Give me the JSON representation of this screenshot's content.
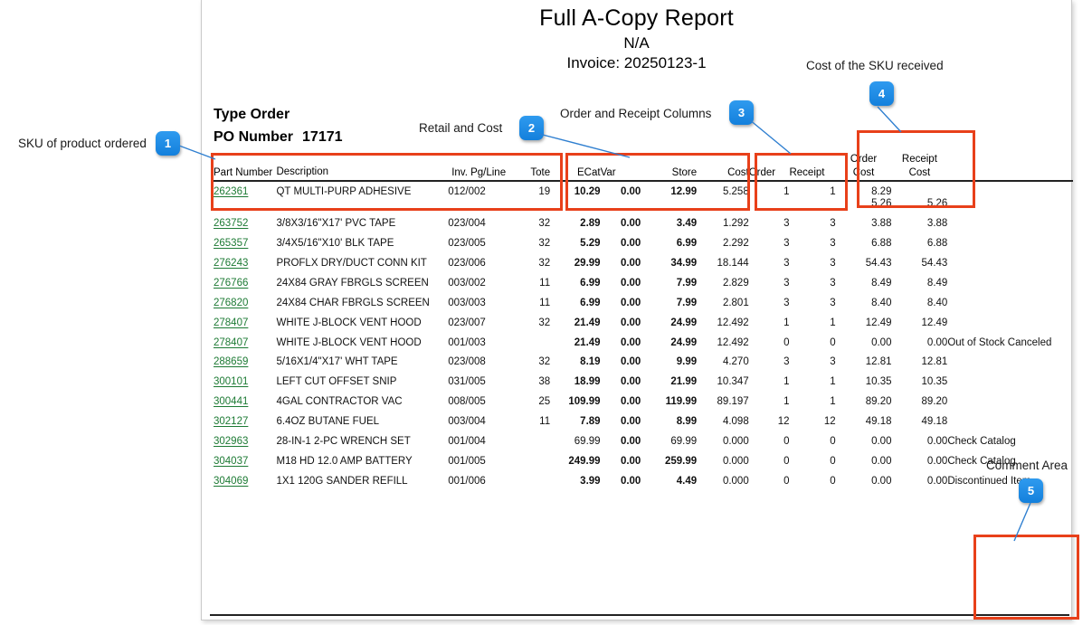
{
  "report": {
    "title": "Full A-Copy Report",
    "subtitle": "N/A",
    "invoice": "Invoice: 20250123-1",
    "type_order": "Type Order",
    "po_label": "PO Number",
    "po_value": "17171"
  },
  "columns": {
    "part_number": "Part Number",
    "description": "Description",
    "inv": "Inv. Pg/Line",
    "tote": "Tote",
    "ecat": "ECat",
    "var": "Var",
    "store": "Store",
    "cost": "Cost",
    "order": "Order",
    "receipt": "Receipt",
    "order_cost_l1": "Order",
    "order_cost_l2": "Cost",
    "receipt_cost_l1": "Receipt",
    "receipt_cost_l2": "Cost"
  },
  "rows": [
    {
      "part": "262361",
      "desc": "QT MULTI-PURP ADHESIVE",
      "inv": "012/002",
      "tote": "19",
      "ecat": "10.29",
      "var": "0.00",
      "store": "12.99",
      "cost": "5.258",
      "order": "1",
      "receipt": "1",
      "order_cost": "5.26",
      "order_cost_alt": "8.29",
      "receipt_cost": "5.26",
      "comment": ""
    },
    {
      "part": "263752",
      "desc": "3/8X3/16\"X17' PVC TAPE",
      "inv": "023/004",
      "tote": "32",
      "ecat": "2.89",
      "var": "0.00",
      "store": "3.49",
      "cost": "1.292",
      "order": "3",
      "receipt": "3",
      "order_cost": "3.88",
      "order_cost_alt": "",
      "receipt_cost": "3.88",
      "comment": ""
    },
    {
      "part": "265357",
      "desc": "3/4X5/16\"X10' BLK TAPE",
      "inv": "023/005",
      "tote": "32",
      "ecat": "5.29",
      "var": "0.00",
      "store": "6.99",
      "cost": "2.292",
      "order": "3",
      "receipt": "3",
      "order_cost": "6.88",
      "order_cost_alt": "",
      "receipt_cost": "6.88",
      "comment": ""
    },
    {
      "part": "276243",
      "desc": "PROFLX DRY/DUCT CONN KIT",
      "inv": "023/006",
      "tote": "32",
      "ecat": "29.99",
      "var": "0.00",
      "store": "34.99",
      "cost": "18.144",
      "order": "3",
      "receipt": "3",
      "order_cost": "54.43",
      "order_cost_alt": "",
      "receipt_cost": "54.43",
      "comment": ""
    },
    {
      "part": "276766",
      "desc": "24X84 GRAY FBRGLS SCREEN",
      "inv": "003/002",
      "tote": "11",
      "ecat": "6.99",
      "var": "0.00",
      "store": "7.99",
      "cost": "2.829",
      "order": "3",
      "receipt": "3",
      "order_cost": "8.49",
      "order_cost_alt": "",
      "receipt_cost": "8.49",
      "comment": ""
    },
    {
      "part": "276820",
      "desc": "24X84 CHAR FBRGLS SCREEN",
      "inv": "003/003",
      "tote": "11",
      "ecat": "6.99",
      "var": "0.00",
      "store": "7.99",
      "cost": "2.801",
      "order": "3",
      "receipt": "3",
      "order_cost": "8.40",
      "order_cost_alt": "",
      "receipt_cost": "8.40",
      "comment": ""
    },
    {
      "part": "278407",
      "desc": "WHITE J-BLOCK VENT HOOD",
      "inv": "023/007",
      "tote": "32",
      "ecat": "21.49",
      "var": "0.00",
      "store": "24.99",
      "cost": "12.492",
      "order": "1",
      "receipt": "1",
      "order_cost": "12.49",
      "order_cost_alt": "",
      "receipt_cost": "12.49",
      "comment": ""
    },
    {
      "part": "278407",
      "desc": "WHITE J-BLOCK VENT HOOD",
      "inv": "001/003",
      "tote": "",
      "ecat": "21.49",
      "var": "0.00",
      "store": "24.99",
      "cost": "12.492",
      "order": "0",
      "receipt": "0",
      "order_cost": "0.00",
      "order_cost_alt": "",
      "receipt_cost": "0.00",
      "comment": "Out of Stock Canceled"
    },
    {
      "part": "288659",
      "desc": "5/16X1/4\"X17' WHT TAPE",
      "inv": "023/008",
      "tote": "32",
      "ecat": "8.19",
      "var": "0.00",
      "store": "9.99",
      "cost": "4.270",
      "order": "3",
      "receipt": "3",
      "order_cost": "12.81",
      "order_cost_alt": "",
      "receipt_cost": "12.81",
      "comment": ""
    },
    {
      "part": "300101",
      "desc": "LEFT CUT OFFSET SNIP",
      "inv": "031/005",
      "tote": "38",
      "ecat": "18.99",
      "var": "0.00",
      "store": "21.99",
      "cost": "10.347",
      "order": "1",
      "receipt": "1",
      "order_cost": "10.35",
      "order_cost_alt": "",
      "receipt_cost": "10.35",
      "comment": ""
    },
    {
      "part": "300441",
      "desc": "4GAL CONTRACTOR VAC",
      "inv": "008/005",
      "tote": "25",
      "ecat": "109.99",
      "var": "0.00",
      "store": "119.99",
      "cost": "89.197",
      "order": "1",
      "receipt": "1",
      "order_cost": "89.20",
      "order_cost_alt": "",
      "receipt_cost": "89.20",
      "comment": ""
    },
    {
      "part": "302127",
      "desc": "6.4OZ BUTANE FUEL",
      "inv": "003/004",
      "tote": "11",
      "ecat": "7.89",
      "var": "0.00",
      "store": "8.99",
      "cost": "4.098",
      "order": "12",
      "receipt": "12",
      "order_cost": "49.18",
      "order_cost_alt": "",
      "receipt_cost": "49.18",
      "comment": ""
    },
    {
      "part": "302963",
      "desc": "28-IN-1 2-PC WRENCH SET",
      "inv": "001/004",
      "tote": "",
      "ecat": "69.99",
      "var": "0.00",
      "store": "69.99",
      "cost": "0.000",
      "order": "0",
      "receipt": "0",
      "order_cost": "0.00",
      "order_cost_alt": "",
      "receipt_cost": "0.00",
      "comment": "Check Catalog"
    },
    {
      "part": "304037",
      "desc": "M18 HD 12.0 AMP BATTERY",
      "inv": "001/005",
      "tote": "",
      "ecat": "249.99",
      "var": "0.00",
      "store": "259.99",
      "cost": "0.000",
      "order": "0",
      "receipt": "0",
      "order_cost": "0.00",
      "order_cost_alt": "",
      "receipt_cost": "0.00",
      "comment": "Check Catalog"
    },
    {
      "part": "304069",
      "desc": "1X1 120G SANDER REFILL",
      "inv": "001/006",
      "tote": "",
      "ecat": "3.99",
      "var": "0.00",
      "store": "4.49",
      "cost": "0.000",
      "order": "0",
      "receipt": "0",
      "order_cost": "0.00",
      "order_cost_alt": "",
      "receipt_cost": "0.00",
      "comment": "Discontinued Item"
    }
  ],
  "annotations": {
    "accent_color": "#e8401a",
    "badge_color": "#1e90e8",
    "items": [
      {
        "number": "1",
        "label": "SKU of product ordered"
      },
      {
        "number": "2",
        "label": "Retail and Cost"
      },
      {
        "number": "3",
        "label": "Order and Receipt Columns"
      },
      {
        "number": "4",
        "label": "Cost of the SKU received"
      },
      {
        "number": "5",
        "label": "Comment Area"
      }
    ]
  },
  "non_bold_ecat_rows": [
    12
  ]
}
